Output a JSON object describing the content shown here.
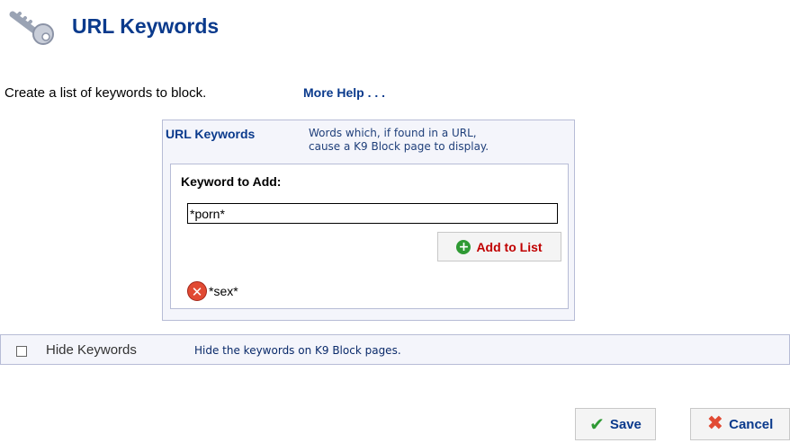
{
  "header": {
    "title": "URL Keywords",
    "icon": "key-icon"
  },
  "intro": {
    "text": "Create a list of keywords to block.",
    "help_link": "More Help . . ."
  },
  "keywords_panel": {
    "title": "URL Keywords",
    "description_line1": "Words which, if found in a URL,",
    "description_line2": "cause a K9 Block page to display.",
    "add_label": "Keyword to Add:",
    "input_value": "*porn*",
    "add_button_label": "Add to List",
    "add_button_icon": "plus-circle-icon",
    "items": [
      {
        "label": "*sex*",
        "icon": "delete-icon"
      }
    ]
  },
  "hide_keywords": {
    "label": "Hide Keywords",
    "description": "Hide the keywords on K9 Block pages.",
    "checked": false
  },
  "footer": {
    "save_label": "Save",
    "cancel_label": "Cancel"
  },
  "colors": {
    "title_blue": "#0a3a8c",
    "add_red": "#c00000",
    "panel_bg": "#f4f5fb",
    "panel_border": "#b7bcd6",
    "save_green": "#2f9a34",
    "cancel_red": "#e14a33"
  }
}
